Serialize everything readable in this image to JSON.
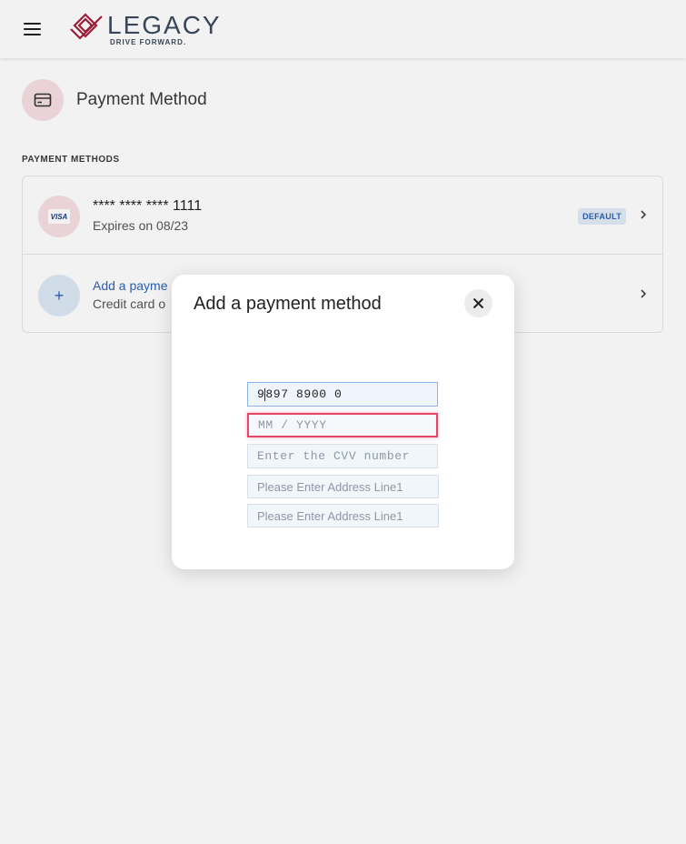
{
  "header": {
    "brand_name": "LEGACY",
    "brand_tagline": "DRIVE FORWARD."
  },
  "page": {
    "title": "Payment Method",
    "section_label": "PAYMENT METHODS"
  },
  "cards": [
    {
      "brand": "VISA",
      "masked_number": "**** **** **** 1111",
      "expiry_text": "Expires on 08/23",
      "badge": "DEFAULT"
    }
  ],
  "add_method": {
    "title": "Add a payme",
    "subtitle": "Credit card o"
  },
  "modal": {
    "title": "Add a payment method",
    "card_number_prefix": "9",
    "card_number_suffix": "897 8900 0",
    "expiry_placeholder": "MM / YYYY",
    "cvv_placeholder": "Enter the CVV number",
    "address1_placeholder": "Please Enter Address Line1",
    "address2_placeholder": "Please Enter Address Line1"
  },
  "colors": {
    "brand_red": "#a3203d",
    "link_blue": "#2e62b5",
    "error_red": "#e5456b"
  },
  "icons": [
    "menu-icon",
    "card-icon",
    "visa-icon",
    "plus-icon",
    "chevron-right-icon",
    "close-icon"
  ]
}
